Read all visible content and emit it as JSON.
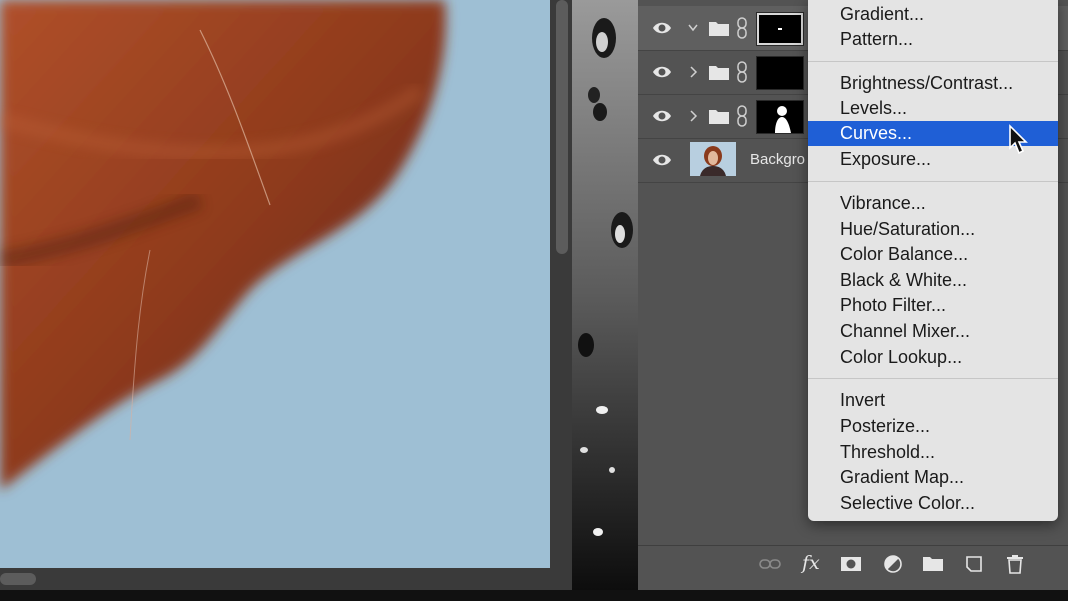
{
  "layers_panel": {
    "layers": [
      {
        "type": "group",
        "expanded": true,
        "mask": "black-with-white-mark",
        "selected": true
      },
      {
        "type": "group",
        "expanded": false,
        "mask": "black"
      },
      {
        "type": "group",
        "expanded": false,
        "mask": "black-with-white-figure"
      },
      {
        "type": "image",
        "name": "Backgro"
      }
    ],
    "footer_icons": [
      "link-icon",
      "fx-icon",
      "mask-icon",
      "adjustment-icon",
      "folder-icon",
      "new-layer-icon",
      "trash-icon"
    ],
    "fx_label": "fx"
  },
  "adjustment_menu": {
    "items": [
      {
        "label": "Gradient..."
      },
      {
        "label": "Pattern..."
      },
      {
        "label": "Brightness/Contrast..."
      },
      {
        "label": "Levels..."
      },
      {
        "label": "Curves...",
        "highlighted": true
      },
      {
        "label": "Exposure..."
      },
      {
        "label": "Vibrance..."
      },
      {
        "label": "Hue/Saturation..."
      },
      {
        "label": "Color Balance..."
      },
      {
        "label": "Black & White..."
      },
      {
        "label": "Photo Filter..."
      },
      {
        "label": "Channel Mixer..."
      },
      {
        "label": "Color Lookup..."
      },
      {
        "label": "Invert"
      },
      {
        "label": "Posterize..."
      },
      {
        "label": "Threshold..."
      },
      {
        "label": "Gradient Map..."
      },
      {
        "label": "Selective Color..."
      }
    ],
    "highlight_color": "#1f5fd6"
  },
  "colors": {
    "canvas_background": "#9ebfd4",
    "hair": "#8a3a1c",
    "panel": "#535353"
  }
}
